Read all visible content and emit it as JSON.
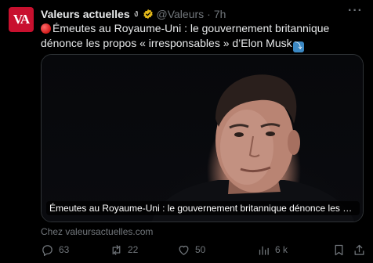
{
  "avatar": {
    "text": "VA"
  },
  "header": {
    "name": "Valeurs actuelles",
    "name_emoji": "ง",
    "handle": "@Valeurs",
    "separator": "·",
    "time": "7h",
    "more": "···"
  },
  "tweet": {
    "text": "Émeutes au Royaume-Uni : le gouvernement britannique dénonce les propos « irresponsables » d’Elon Musk",
    "arrow_badge": "⤵"
  },
  "card": {
    "caption": "Émeutes au Royaume-Uni : le gouvernement britannique dénonce les propos « i...",
    "source": "Chez valeursactuelles.com"
  },
  "actions": {
    "replies": "63",
    "reposts": "22",
    "likes": "50",
    "views": "6 k"
  },
  "colors": {
    "brand": "#c8102e",
    "verified": "#e2b719",
    "muted": "#71767b",
    "text": "#e7e9ea",
    "background": "#000000"
  },
  "icons": [
    "reply-icon",
    "repost-icon",
    "like-icon",
    "views-icon",
    "bookmark-icon",
    "share-icon",
    "verified-icon",
    "more-icon"
  ]
}
